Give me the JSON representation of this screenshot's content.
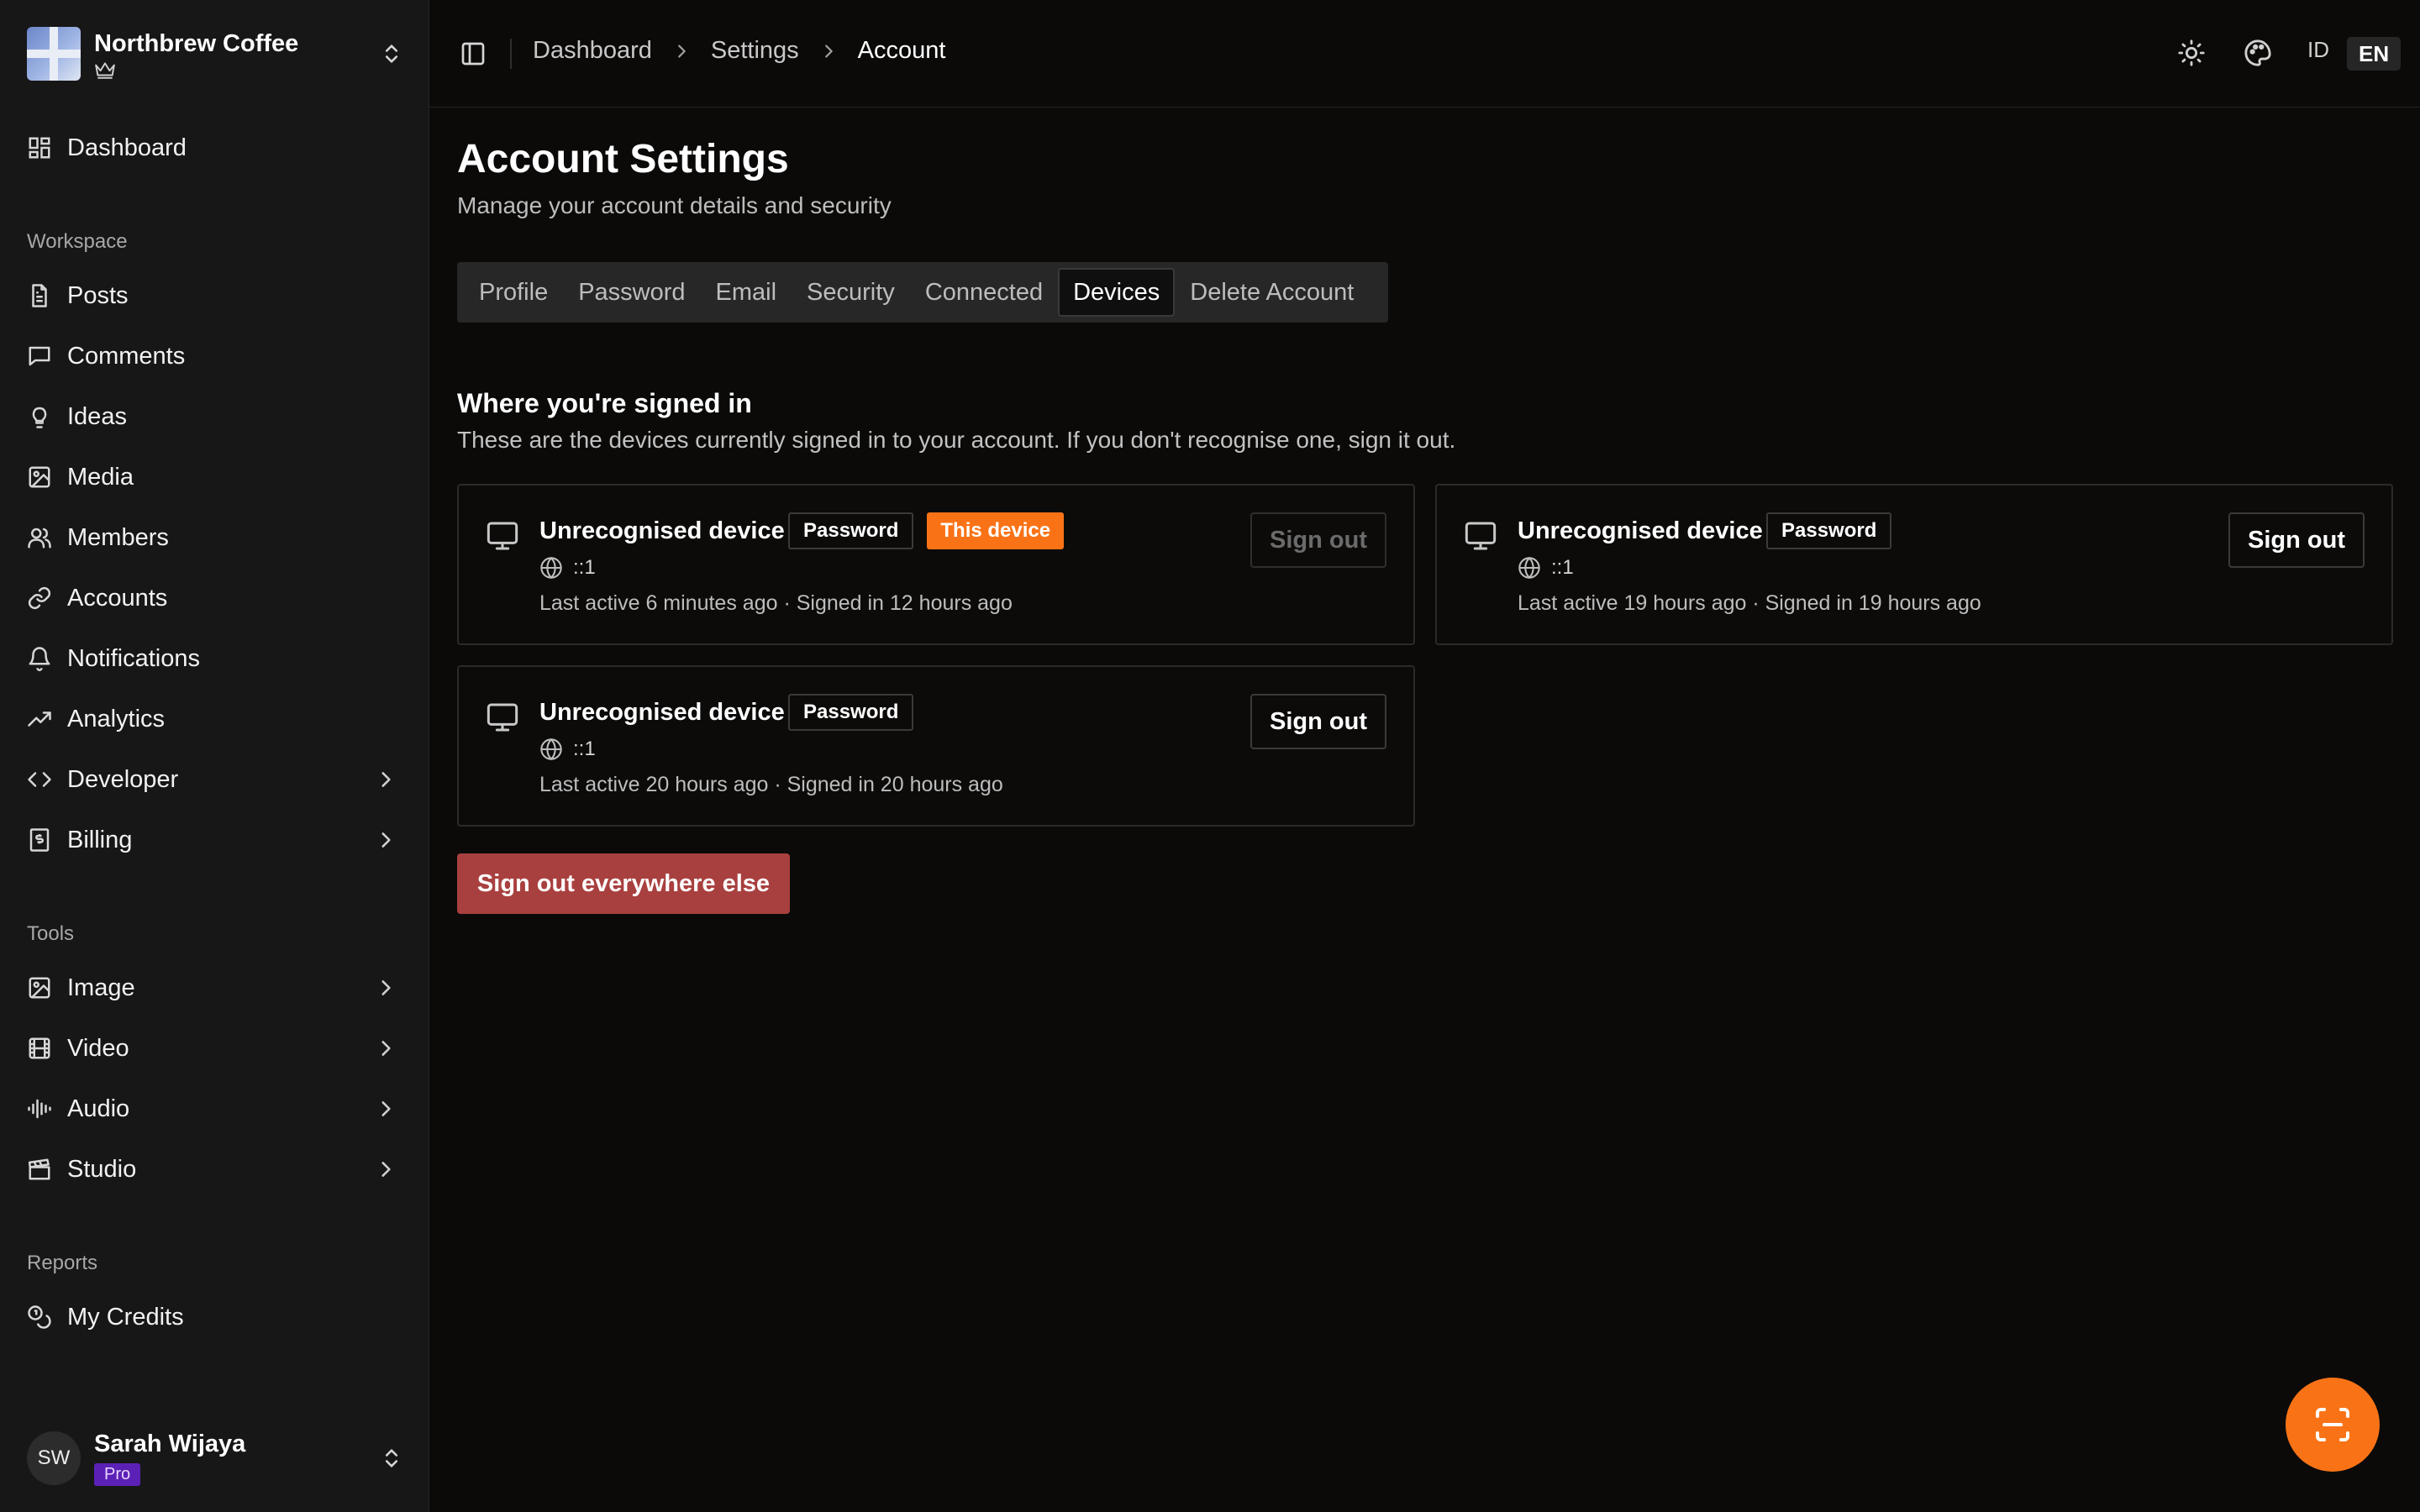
{
  "org": {
    "name": "Northbrew Coffee",
    "plan_icon": "crown-icon"
  },
  "sidebar": {
    "top_items": [
      {
        "label": "Dashboard",
        "icon": "dashboard-icon"
      }
    ],
    "sections": [
      {
        "title": "Workspace",
        "items": [
          {
            "label": "Posts",
            "icon": "file-text-icon"
          },
          {
            "label": "Comments",
            "icon": "message-square-icon"
          },
          {
            "label": "Ideas",
            "icon": "lightbulb-icon"
          },
          {
            "label": "Media",
            "icon": "image-icon"
          },
          {
            "label": "Members",
            "icon": "users-icon"
          },
          {
            "label": "Accounts",
            "icon": "link-icon"
          },
          {
            "label": "Notifications",
            "icon": "bell-icon"
          },
          {
            "label": "Analytics",
            "icon": "trending-up-icon"
          },
          {
            "label": "Developer",
            "icon": "code-icon",
            "has_children": true
          },
          {
            "label": "Billing",
            "icon": "receipt-icon",
            "has_children": true
          }
        ]
      },
      {
        "title": "Tools",
        "items": [
          {
            "label": "Image",
            "icon": "image-icon",
            "has_children": true
          },
          {
            "label": "Video",
            "icon": "film-icon",
            "has_children": true
          },
          {
            "label": "Audio",
            "icon": "audio-waveform-icon",
            "has_children": true
          },
          {
            "label": "Studio",
            "icon": "clapperboard-icon",
            "has_children": true
          }
        ]
      },
      {
        "title": "Reports",
        "items": [
          {
            "label": "My Credits",
            "icon": "coins-icon"
          }
        ]
      }
    ]
  },
  "user": {
    "initials": "SW",
    "name": "Sarah Wijaya",
    "plan": "Pro"
  },
  "header": {
    "breadcrumbs": [
      "Dashboard",
      "Settings",
      "Account"
    ],
    "lang_options": [
      "ID",
      "EN"
    ],
    "active_lang": "EN"
  },
  "page": {
    "title": "Account Settings",
    "subtitle": "Manage your account details and security"
  },
  "tabs": [
    "Profile",
    "Password",
    "Email",
    "Security",
    "Connected",
    "Devices",
    "Delete Account"
  ],
  "active_tab": "Devices",
  "devices_section": {
    "title": "Where you're signed in",
    "description": "These are the devices currently signed in to your account. If you don't recognise one, sign it out.",
    "devices": [
      {
        "name": "Unrecognised device",
        "method": "Password",
        "this_device_label": "This device",
        "is_current": true,
        "ip": "::1",
        "meta": "Last active 6 minutes ago · Signed in 12 hours ago",
        "action": "Sign out"
      },
      {
        "name": "Unrecognised device",
        "method": "Password",
        "is_current": false,
        "ip": "::1",
        "meta": "Last active 19 hours ago · Signed in 19 hours ago",
        "action": "Sign out"
      },
      {
        "name": "Unrecognised device",
        "method": "Password",
        "is_current": false,
        "ip": "::1",
        "meta": "Last active 20 hours ago · Signed in 20 hours ago",
        "action": "Sign out"
      }
    ],
    "sign_out_all_label": "Sign out everywhere else"
  },
  "colors": {
    "accent": "#f97316",
    "danger": "#a8403f",
    "pro": "#5b21b6"
  }
}
